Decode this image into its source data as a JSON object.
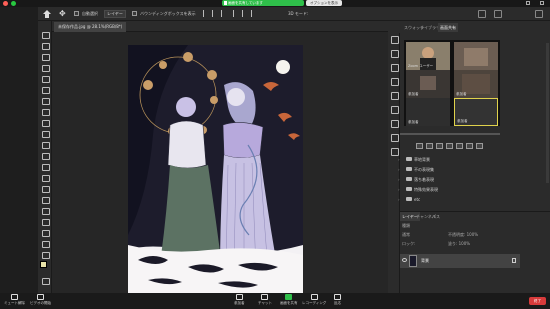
{
  "zoom_top": {
    "share_label": "画面を共有しています",
    "options_label": "オプションを表示",
    "controls_light": [
      "#ff5f57",
      "#28c840"
    ]
  },
  "options_bar": {
    "auto_select_label": "自動選択",
    "layer_select": "レイヤー",
    "transform_label": "バウンディングボックスを表示",
    "mode3d_label": "3D モード:"
  },
  "document": {
    "tab_title": "未保存作品.jpg @ 28.1%(RGB/8*)"
  },
  "panels": {
    "top_tabs": [
      "スウォッチ",
      "ライブラリ",
      "画面共有"
    ],
    "active_top_tab": 2,
    "video_tiles": [
      {
        "name": "Zoom ユーザー"
      },
      {
        "name": ""
      },
      {
        "name": "参加者"
      },
      {
        "name": "参加者"
      },
      {
        "name": "参加者"
      },
      {
        "name": "参加者"
      }
    ],
    "folders": [
      {
        "label": "草地背景"
      },
      {
        "label": "不の表現集"
      },
      {
        "label": "落ち着表現"
      },
      {
        "label": "特殊効果表現"
      },
      {
        "label": "etc"
      }
    ],
    "layer_tabs": [
      "レイヤー",
      "チャンネル",
      "パス"
    ],
    "active_layer_tab": 0,
    "layer_kind_label": "種類",
    "blend_mode": "通常",
    "opacity_label": "不透明度: 100%",
    "lock_label": "ロック:",
    "fill_label": "塗り: 100%",
    "layer_name": "背景"
  },
  "zoom_bottom": {
    "items": [
      {
        "label": "ミュート解除"
      },
      {
        "label": "ビデオの開始"
      },
      {
        "label": "参加者"
      },
      {
        "label": "チャット"
      },
      {
        "label": "画面を共有"
      },
      {
        "label": "レコーディング"
      },
      {
        "label": "反応"
      }
    ],
    "participant_count": "3",
    "end_label": "終了"
  },
  "colors": {
    "ps_bg": "#2b2b2b",
    "canvas_bg": "#262626",
    "share_green": "#2fbf4a",
    "end_red": "#d83b3b",
    "active_tile": "#e0d24c"
  }
}
